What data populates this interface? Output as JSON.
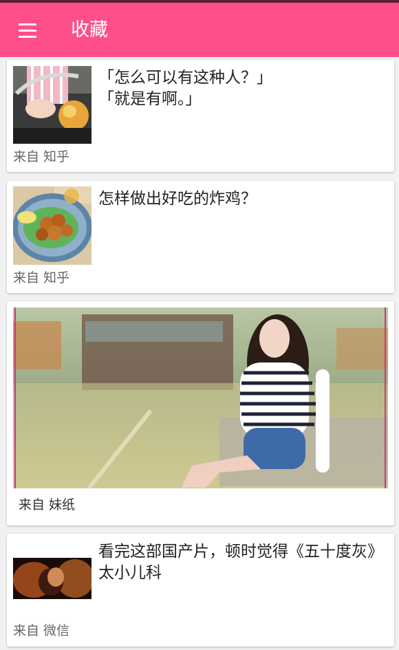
{
  "app": {
    "title": "收藏"
  },
  "toolbar": {
    "menu_icon": "hamburger-menu-icon"
  },
  "cards": [
    {
      "headline": "「怎么可以有这种人？」\n「就是有啊。」",
      "source": "来自 知乎"
    },
    {
      "headline": "怎样做出好吃的炸鸡？",
      "source": "来自 知乎"
    },
    {
      "source": "来自 妹纸"
    },
    {
      "headline": "看完这部国产片，顿时觉得《五十度灰》太小儿科",
      "source": "来自 微信"
    }
  ],
  "colors": {
    "accent": "#fe4e8c",
    "status_bar": "#5b2035"
  }
}
